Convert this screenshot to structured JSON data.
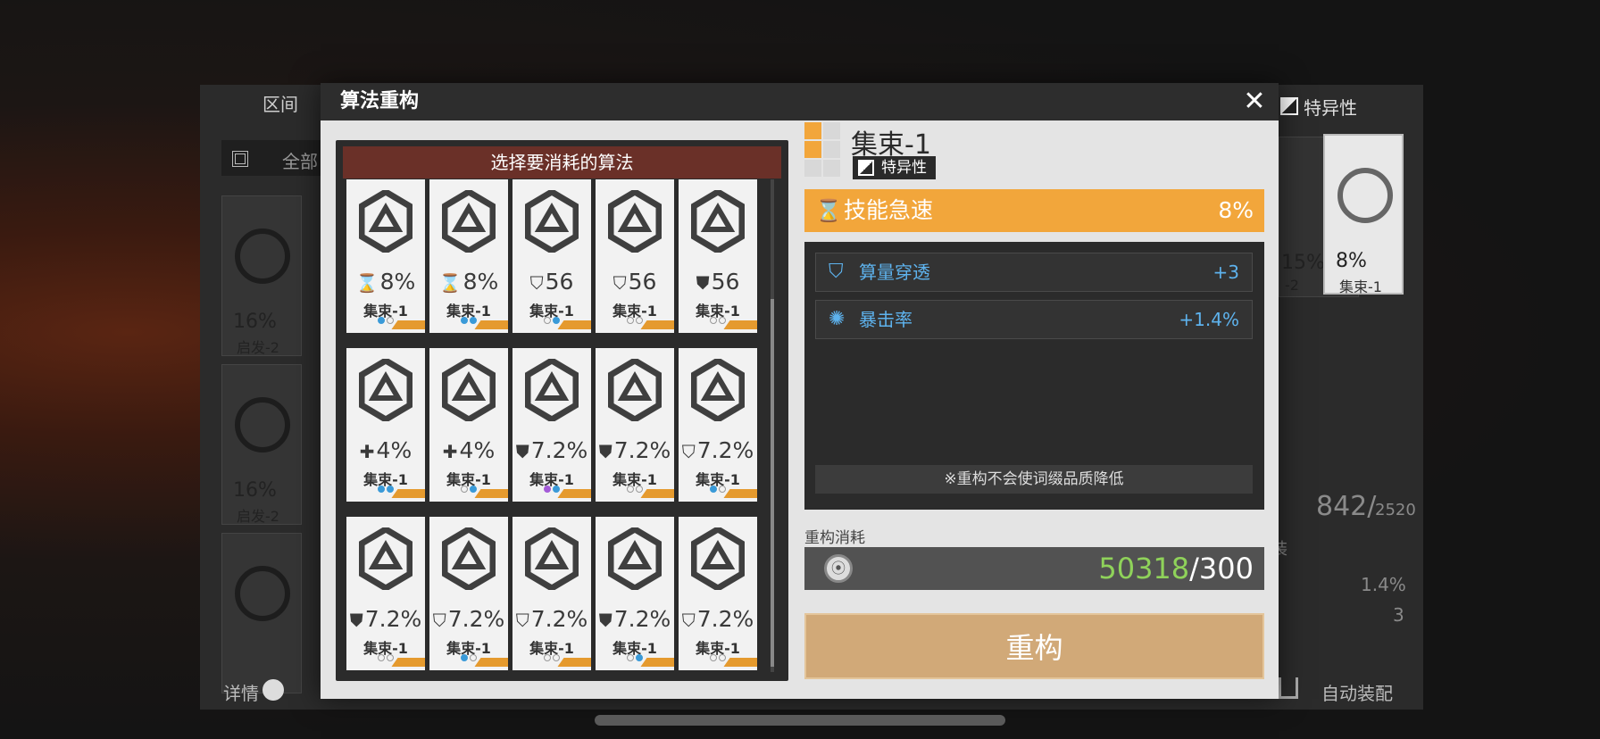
{
  "background": {
    "tab_interval": "区间",
    "tab_all": "全部",
    "special_tab": "特异性",
    "cards": [
      {
        "value": "16%",
        "name": "启发-2"
      },
      {
        "value": "16%",
        "name": "启发-2"
      },
      {
        "value": "15%",
        "name": "-2"
      },
      {
        "value": "8%",
        "name": "集束-1"
      }
    ],
    "capacity": "842/",
    "capacity_max": "2520",
    "install_label": "装",
    "stat_values": [
      "1.4%",
      "3"
    ],
    "details_label": "详情",
    "auto_equip": "自动装配"
  },
  "modal": {
    "title": "算法重构",
    "close_symbol": "✕",
    "grid_header": "选择要消耗的算法",
    "cards": [
      {
        "icon": "hourglass",
        "value": "8%",
        "name": "集束-1",
        "dots": [
          "b",
          "o"
        ]
      },
      {
        "icon": "hourglass",
        "value": "8%",
        "name": "集束-1",
        "dots": [
          "b",
          "b"
        ]
      },
      {
        "icon": "shield-bolt",
        "value": "56",
        "name": "集束-1",
        "dots": [
          "o",
          "b"
        ]
      },
      {
        "icon": "shield-bolt",
        "value": "56",
        "name": "集束-1",
        "dots": [
          "o",
          "o"
        ]
      },
      {
        "icon": "shield",
        "value": "56",
        "name": "集束-1",
        "dots": [
          "o",
          "o"
        ]
      },
      {
        "icon": "cross",
        "value": "4%",
        "name": "集束-1",
        "dots": [
          "b",
          "b"
        ]
      },
      {
        "icon": "cross",
        "value": "4%",
        "name": "集束-1",
        "dots": [
          "o",
          "b"
        ]
      },
      {
        "icon": "shield",
        "value": "7.2%",
        "name": "集束-1",
        "dots": [
          "p",
          "b"
        ]
      },
      {
        "icon": "shield",
        "value": "7.2%",
        "name": "集束-1",
        "dots": [
          "o",
          "o"
        ]
      },
      {
        "icon": "shield-bolt",
        "value": "7.2%",
        "name": "集束-1",
        "dots": [
          "b",
          "o"
        ]
      },
      {
        "icon": "shield",
        "value": "7.2%",
        "name": "集束-1",
        "dots": [
          "o",
          "o"
        ]
      },
      {
        "icon": "shield-bolt",
        "value": "7.2%",
        "name": "集束-1",
        "dots": [
          "b",
          "o"
        ]
      },
      {
        "icon": "shield-bolt",
        "value": "7.2%",
        "name": "集束-1",
        "dots": [
          "o",
          "o"
        ]
      },
      {
        "icon": "shield",
        "value": "7.2%",
        "name": "集束-1",
        "dots": [
          "o",
          "b"
        ]
      },
      {
        "icon": "shield-bolt",
        "value": "7.2%",
        "name": "集束-1",
        "dots": [
          "o",
          "o"
        ]
      }
    ],
    "item": {
      "name": "集束-1",
      "badge": "特异性",
      "main_stat": {
        "label": "技能急速",
        "value": "8%",
        "icon": "⌛"
      },
      "sub_stats": [
        {
          "icon": "⛉",
          "label": "算量穿透",
          "value": "+3"
        },
        {
          "icon": "✺",
          "label": "暴击率",
          "value": "+1.4%"
        }
      ],
      "note": "※重构不会使词缀品质降低"
    },
    "cost": {
      "label": "重构消耗",
      "have": "50318",
      "separator": "/",
      "need": "300",
      "coin_icon": "⦿"
    },
    "rebuild_button": "重构"
  },
  "colors": {
    "accent": "#f2a63b",
    "button": "#d1a978",
    "header": "#6a3028",
    "substat": "#5eb3ee",
    "have": "#8fd25a"
  }
}
